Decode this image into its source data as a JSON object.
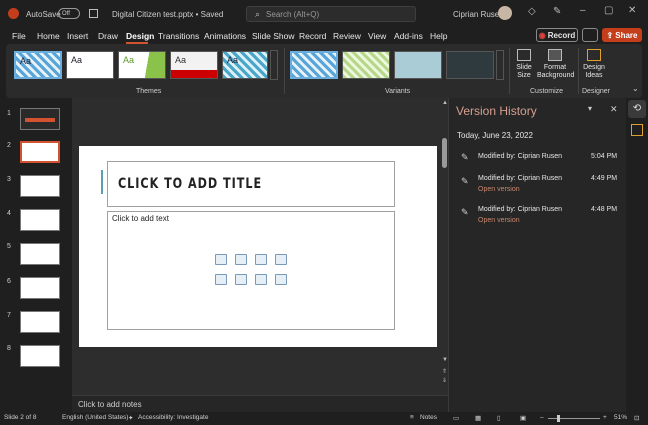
{
  "titlebar": {
    "autosave": "AutoSave",
    "toggle": "Off",
    "filename": "Digital Citizen test.pptx • Saved",
    "search_placeholder": "Search (Alt+Q)",
    "user": "Ciprian Rusen"
  },
  "menu": {
    "items": [
      "File",
      "Home",
      "Insert",
      "Draw",
      "Design",
      "Transitions",
      "Animations",
      "Slide Show",
      "Record",
      "Review",
      "View",
      "Add-ins",
      "Help"
    ],
    "active": "Design",
    "record_label": "Record",
    "share_label": "Share"
  },
  "ribbon": {
    "themes_label": "Themes",
    "variants_label": "Variants",
    "customize_label": "Customize",
    "designer_label": "Designer",
    "slide_size": "Slide Size",
    "format_bg": "Format Background",
    "design_ideas": "Design Ideas",
    "theme_samples": [
      "Aa",
      "Aa",
      "Aa",
      "Aa",
      "Aa"
    ]
  },
  "slides": {
    "numbers": [
      "1",
      "2",
      "3",
      "4",
      "5",
      "6",
      "7",
      "8"
    ]
  },
  "slide": {
    "title_placeholder": "CLICK TO ADD TITLE",
    "content_placeholder": "Click to add text",
    "notes_placeholder": "Click to add notes"
  },
  "version_history": {
    "title": "Version History",
    "date": "Today, June 23, 2022",
    "entries": [
      {
        "modified": "Modified by: Ciprian Rusen",
        "time": "5:04 PM",
        "link": ""
      },
      {
        "modified": "Modified by: Ciprian Rusen",
        "time": "4:49 PM",
        "link": "Open version"
      },
      {
        "modified": "Modified by: Ciprian Rusen",
        "time": "4:48 PM",
        "link": "Open version"
      }
    ]
  },
  "statusbar": {
    "slide_info": "Slide 2 of 8",
    "language": "English (United States)",
    "accessibility": "Accessibility: Investigate",
    "notes": "Notes",
    "zoom": "51%"
  },
  "colors": {
    "accent": "#d35230",
    "share": "#c43e1c",
    "version_title": "#d6a08f",
    "link": "#c9876e"
  }
}
